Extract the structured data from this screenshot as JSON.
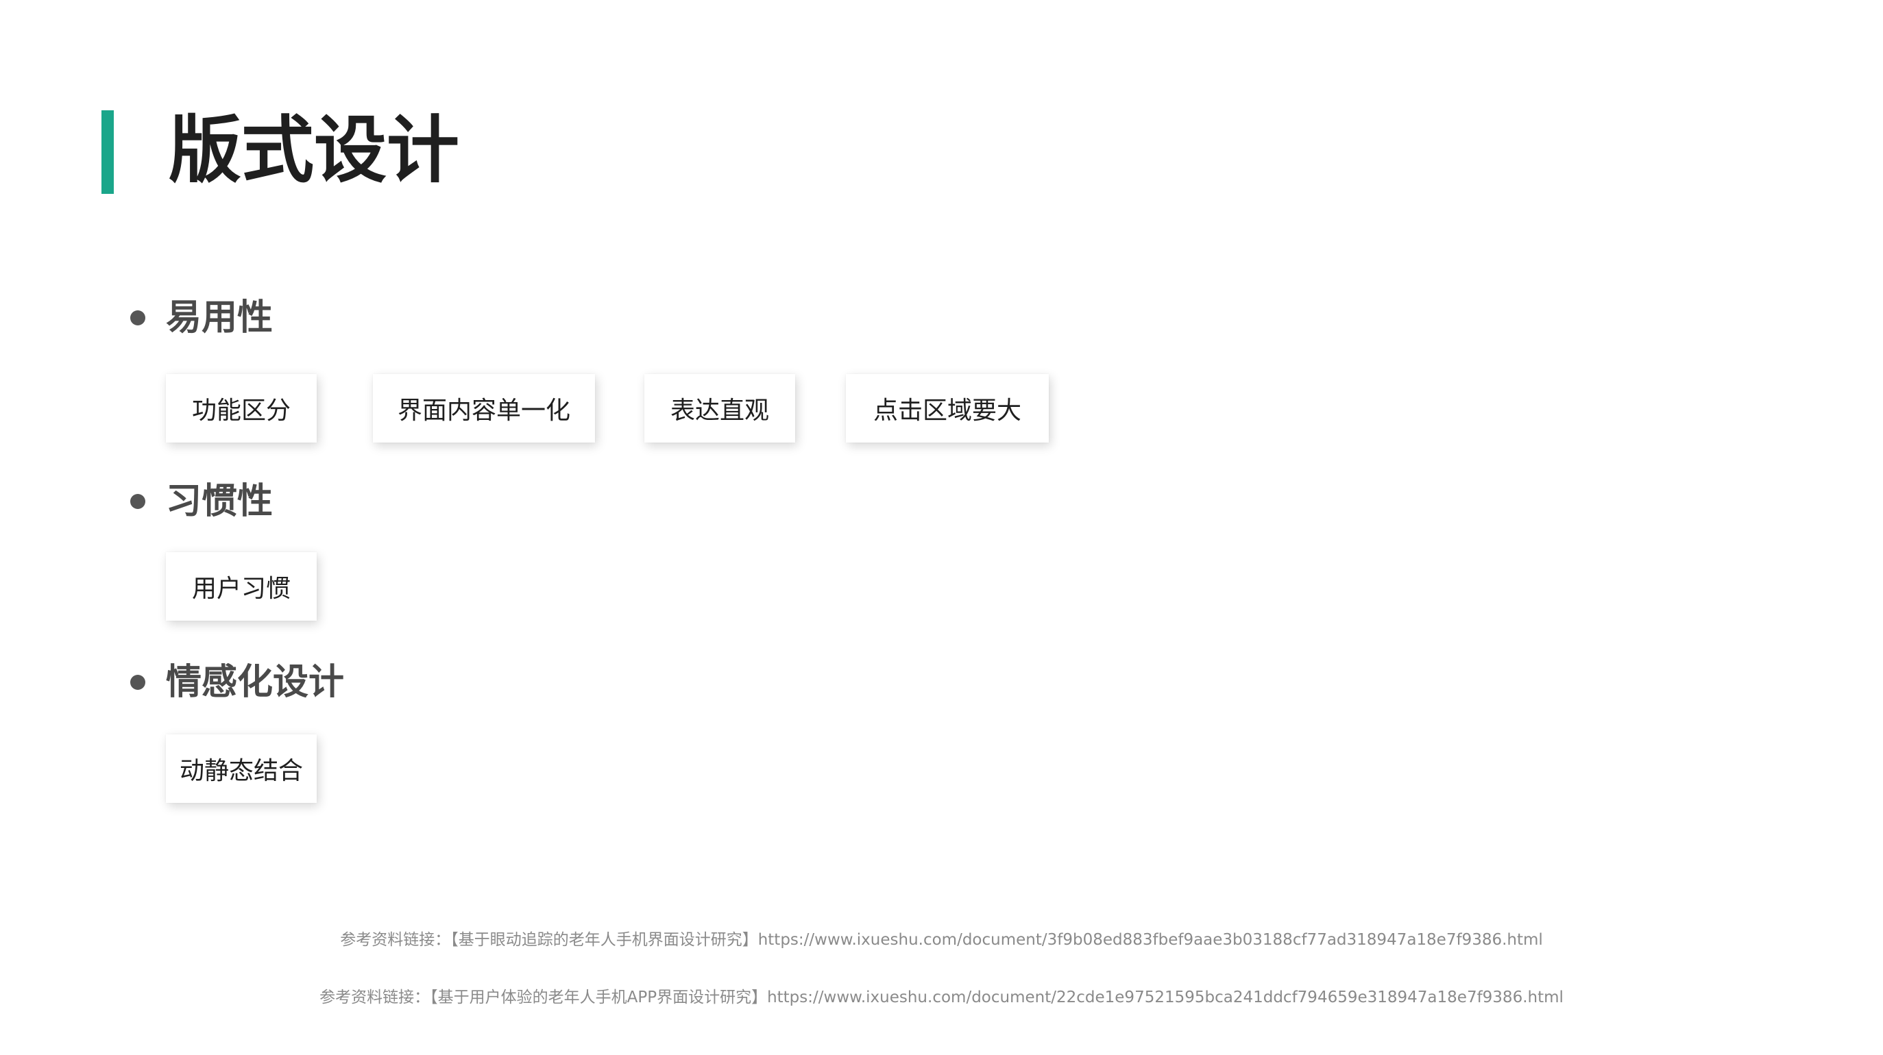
{
  "title": "版式设计",
  "sections": [
    {
      "heading": "易用性",
      "tags": [
        "功能区分",
        "界面内容单一化",
        "表达直观",
        "点击区域要大"
      ]
    },
    {
      "heading": "习惯性",
      "tags": [
        "用户习惯"
      ]
    },
    {
      "heading": "情感化设计",
      "tags": [
        "动静态结合"
      ]
    }
  ],
  "references": [
    "参考资料链接：【基于眼动追踪的老年人手机界面设计研究】https://www.ixueshu.com/document/3f9b08ed883fbef9aae3b03188cf77ad318947a18e7f9386.html",
    "参考资料链接：【基于用户体验的老年人手机APP界面设计研究】https://www.ixueshu.com/document/22cde1e97521595bca241ddcf794659e318947a18e7f9386.html"
  ],
  "colors": {
    "accent": "#1aa68a",
    "title": "#1f1f1f",
    "heading": "#4a4a4a",
    "reference": "#8a8a8a"
  }
}
